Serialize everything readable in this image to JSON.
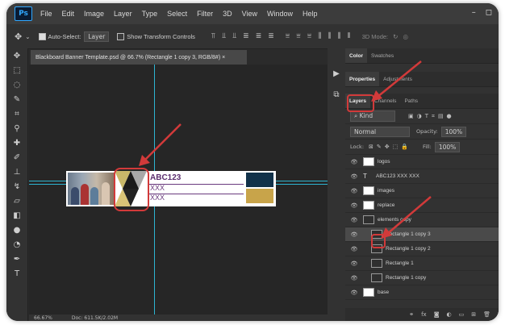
{
  "app": {
    "logo_text": "Ps",
    "menu": [
      "File",
      "Edit",
      "Image",
      "Layer",
      "Type",
      "Select",
      "Filter",
      "3D",
      "View",
      "Window",
      "Help"
    ],
    "window_controls": [
      "–",
      "◻"
    ]
  },
  "options_bar": {
    "auto_select_label": "Auto-Select:",
    "auto_select_target": "Layer",
    "show_transform_label": "Show Transform Controls",
    "mode_3d_label": "3D Mode:"
  },
  "document": {
    "tab_title": "Blackboard Banner Template.psd @ 66.7% (Rectangle 1 copy 3, RGB/8#) ×"
  },
  "banner": {
    "heading": "ABC123",
    "line1": "XXX",
    "line2": "XXX"
  },
  "status": {
    "zoom": "66.67%",
    "doc": "Doc: 611.5K/2.02M"
  },
  "panels": {
    "top_tabs": [
      "Color",
      "Swatches"
    ],
    "mid_tabs": [
      "Properties",
      "Adjustments"
    ],
    "layer_tabs": [
      "Layers",
      "Channels",
      "Paths"
    ],
    "filter_kind": "Kind",
    "blend_mode": "Normal",
    "opacity_label": "Opacity:",
    "opacity_value": "100%",
    "lock_label": "Lock:",
    "fill_label": "Fill:",
    "fill_value": "100%"
  },
  "layers": [
    {
      "name": "logos",
      "type": "group-mask",
      "selected": false
    },
    {
      "name": "ABC123 XXX XXX",
      "type": "text",
      "selected": false
    },
    {
      "name": "images",
      "type": "group-mask",
      "selected": false
    },
    {
      "name": "replace",
      "type": "image",
      "selected": false
    },
    {
      "name": "elements copy",
      "type": "folder",
      "selected": false
    },
    {
      "name": "Rectangle 1 copy 3",
      "type": "shape",
      "selected": true
    },
    {
      "name": "Rectangle 1 copy 2",
      "type": "shape",
      "selected": false
    },
    {
      "name": "Rectangle 1",
      "type": "shape",
      "selected": false
    },
    {
      "name": "Rectangle 1 copy",
      "type": "shape",
      "selected": false
    },
    {
      "name": "base",
      "type": "image",
      "selected": false
    }
  ],
  "colors": {
    "accent_red": "#d23a3a",
    "banner_purple": "#5a2d6e",
    "guide_cyan": "#2db5d2"
  }
}
